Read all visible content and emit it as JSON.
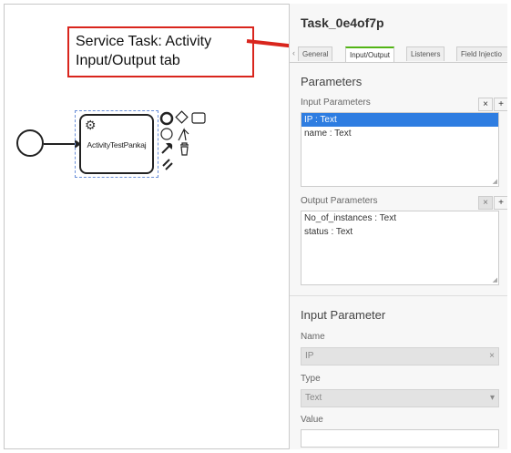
{
  "annotation": {
    "line1": "Service Task: Activity",
    "line2": "Input/Output tab"
  },
  "diagram": {
    "task_label": "ActivityTestPankaj",
    "icons": {
      "task_type": "gear-icon",
      "context_pad": [
        "end-event-icon",
        "gateway-icon",
        "task-icon",
        "intermediate-event-icon",
        "connect-icon",
        "wrench-icon",
        "trash-icon",
        "text-annotation-icon"
      ]
    }
  },
  "panel": {
    "title": "Task_0e4of7p",
    "tabs": [
      {
        "label": "General"
      },
      {
        "label": "Input/Output",
        "active": true
      },
      {
        "label": "Listeners"
      },
      {
        "label": "Field Injectio"
      }
    ],
    "parameters_heading": "Parameters",
    "input_parameters": {
      "label": "Input Parameters",
      "items": [
        "IP : Text",
        "name : Text"
      ],
      "selected_index": 0
    },
    "output_parameters": {
      "label": "Output Parameters",
      "items": [
        "No_of_instances : Text",
        "status : Text"
      ]
    },
    "detail": {
      "heading": "Input Parameter",
      "name_label": "Name",
      "name_value": "IP",
      "name_clear": "×",
      "type_label": "Type",
      "type_value": "Text",
      "type_arrow": "▾",
      "value_label": "Value",
      "value_value": ""
    },
    "list_buttons": {
      "remove": "×",
      "add": "+"
    }
  },
  "colors": {
    "annotation_border": "#d9251d",
    "selected_item": "#2e7de1",
    "active_tab_accent": "#52b415"
  }
}
